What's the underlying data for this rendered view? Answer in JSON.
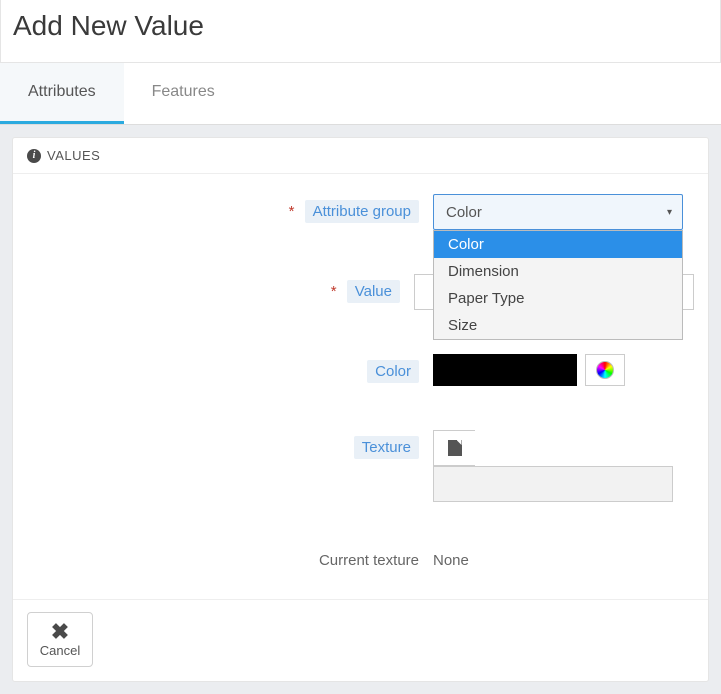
{
  "header": {
    "title": "Add New Value"
  },
  "tabs": {
    "attributes": "Attributes",
    "features": "Features"
  },
  "panel": {
    "title": "VALUES"
  },
  "form": {
    "attribute_group": {
      "label": "Attribute group",
      "selected": "Color",
      "options": [
        "Color",
        "Dimension",
        "Paper Type",
        "Size"
      ]
    },
    "value": {
      "label": "Value"
    },
    "color": {
      "label": "Color",
      "value": "#000000"
    },
    "texture": {
      "label": "Texture"
    },
    "current_texture": {
      "label": "Current texture",
      "value": "None"
    }
  },
  "buttons": {
    "cancel": "Cancel"
  }
}
